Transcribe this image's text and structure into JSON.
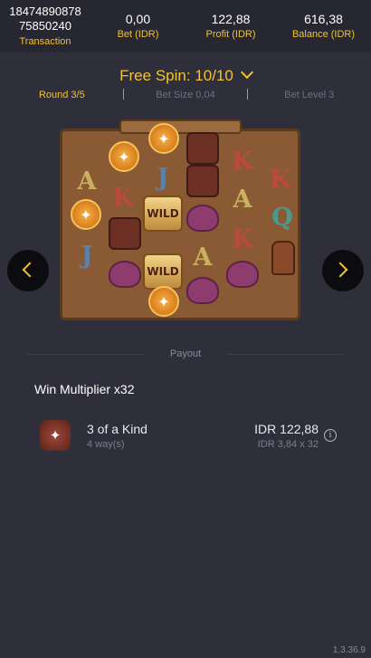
{
  "header": {
    "transaction": {
      "line1": "18474890878",
      "line2": "75850240",
      "label": "Transaction"
    },
    "bet": {
      "value": "0,00",
      "label": "Bet (IDR)"
    },
    "profit": {
      "value": "122,88",
      "label": "Profit (IDR)"
    },
    "balance": {
      "value": "616,38",
      "label": "Balance (IDR)"
    }
  },
  "free_spin": {
    "title": "Free Spin: 10/10"
  },
  "info": {
    "round": "Round 3/5",
    "bet_size": "Bet Size 0,04",
    "bet_level": "Bet Level 3"
  },
  "board": {
    "symbols": {
      "A": "A",
      "K": "K",
      "J": "J",
      "Q": "Q",
      "wild": "WILD",
      "icons": [
        "revolver-icon",
        "cowboy-hat-icon",
        "cowboy-icon",
        "whiskey-bottle-icon"
      ]
    }
  },
  "payout": {
    "label": "Payout"
  },
  "win": {
    "multiplier": "Win Multiplier x32",
    "name": "3 of a Kind",
    "ways": "4 way(s)",
    "amount": "IDR 122,88",
    "calc": "IDR 3,84 x 32"
  },
  "version": "1.3.36.9",
  "colors": {
    "accent": "#f2c230",
    "background": "#2f2f3b",
    "header": "#272731"
  }
}
